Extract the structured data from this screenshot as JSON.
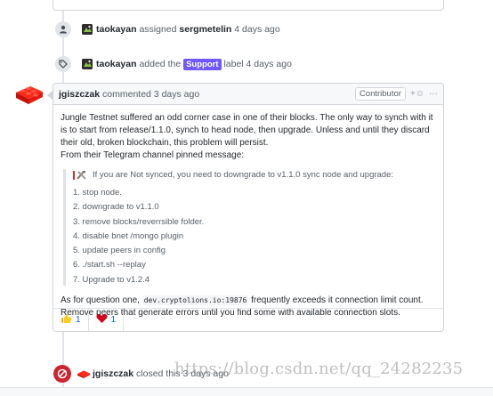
{
  "events": {
    "assigned": {
      "actor": "taokayan",
      "verb": "assigned",
      "target": "sergmetelin",
      "time": "4 days ago"
    },
    "labeled": {
      "actor": "taokayan",
      "verb": "added the",
      "label": "Support",
      "label_suffix": "label 4 days ago",
      "label_color": "#7057ff"
    },
    "closed": {
      "actor": "jgiszczak",
      "text": "closed this 3 days ago",
      "badge_color": "#cb2431"
    }
  },
  "comment": {
    "author": "jgiszczak",
    "action": "commented 3 days ago",
    "role": "Contributor",
    "add_reaction_icon": "smiley-plus-icon",
    "more_icon": "kebab-horizontal-icon",
    "paragraph1": "Jungle Testnet suffered an odd corner case in one of their blocks. The only way to synch with it is to start from release/1.1.0, synch to head node, then upgrade. Unless and until they discard their old, broken blockchain, this problem will persist.",
    "paragraph2": "From their Telegram channel pinned message:",
    "quote_intro": "If you are Not synced, you need to downgrade to v1.1.0 sync node and upgrade:",
    "steps": [
      "1. stop node.",
      "2. downgrade to v1.1.0",
      "3. remove blocks/reverrsible folder.",
      "4. disable bnet /mongo plugin",
      "5. update peers in config",
      "6. ./start.sh --replay",
      "7. Upgrade to v1.2.4"
    ],
    "answer_prefix": "As for question one,",
    "answer_code": "dev.cryptolions.io:19876",
    "answer_suffix": "frequently exceeds it connection limit count. Remove peers that generate errors until you find some with available connection slots.",
    "reactions": [
      {
        "icon": "thumbs-up-icon",
        "count": "1"
      },
      {
        "icon": "heart-icon",
        "count": "1"
      }
    ]
  },
  "watermark": "https://blog.csdn.net/qq_24282235",
  "colors": {
    "link": "#0366d6",
    "border": "#d1d5da",
    "muted": "#586069",
    "closed_red": "#cb2431"
  }
}
